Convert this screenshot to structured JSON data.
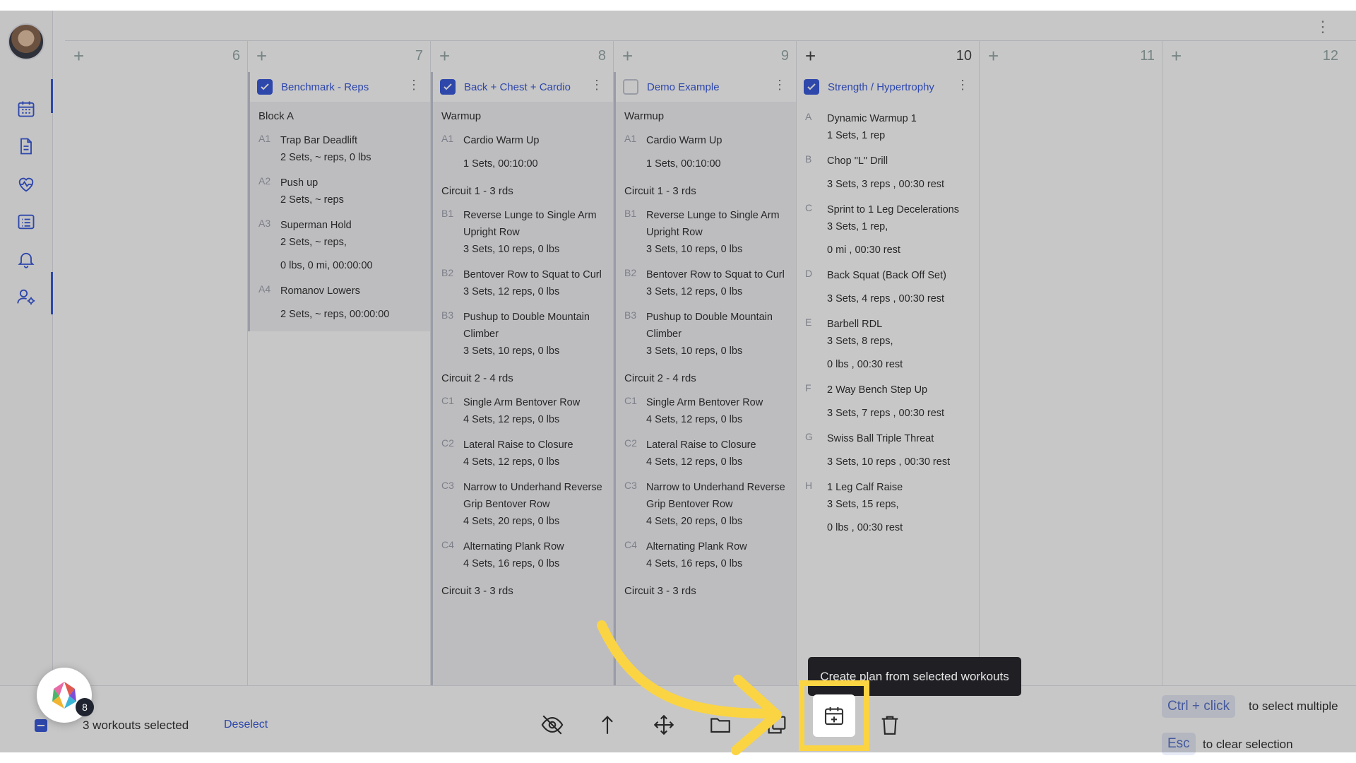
{
  "calendar": {
    "days": [
      "6",
      "7",
      "8",
      "9",
      "10",
      "11",
      "12"
    ],
    "workouts": [
      {
        "title": "Benchmark - Reps",
        "checked": true,
        "blocks": [
          {
            "section": "Block A",
            "items": [
              {
                "label": "A1",
                "name": "Trap Bar Deadlift",
                "details": [
                  "2 Sets, ~ reps, 0 lbs"
                ]
              },
              {
                "label": "A2",
                "name": "Push up",
                "details": [
                  "2 Sets, ~ reps"
                ]
              },
              {
                "label": "A3",
                "name": "Superman Hold",
                "details": [
                  "2 Sets, ~ reps,",
                  "0 lbs, 0 mi, 00:00:00"
                ]
              },
              {
                "label": "A4",
                "name": "Romanov Lowers",
                "details": [
                  "2 Sets, ~ reps, 00:00:00"
                ]
              }
            ]
          }
        ]
      },
      {
        "title": "Back + Chest + Cardio",
        "checked": true,
        "blocks": [
          {
            "section": "Warmup",
            "items": [
              {
                "label": "A1",
                "name": "Cardio Warm Up",
                "details": [
                  "1 Sets, 00:10:00"
                ]
              }
            ]
          },
          {
            "section": "Circuit 1 - 3 rds",
            "items": [
              {
                "label": "B1",
                "name": "Reverse Lunge to Single Arm Upright Row",
                "details": [
                  "3 Sets, 10 reps, 0 lbs"
                ]
              },
              {
                "label": "B2",
                "name": "Bentover Row to Squat to Curl",
                "details": [
                  "3 Sets, 12 reps, 0 lbs"
                ]
              },
              {
                "label": "B3",
                "name": "Pushup to Double Mountain Climber",
                "details": [
                  "3 Sets, 10 reps, 0 lbs"
                ]
              }
            ]
          },
          {
            "section": "Circuit 2 - 4 rds",
            "items": [
              {
                "label": "C1",
                "name": "Single Arm Bentover Row",
                "details": [
                  "4 Sets, 12 reps, 0 lbs"
                ]
              },
              {
                "label": "C2",
                "name": "Lateral Raise to Closure",
                "details": [
                  "4 Sets, 12 reps, 0 lbs"
                ]
              },
              {
                "label": "C3",
                "name": "Narrow to Underhand Reverse Grip Bentover Row",
                "details": [
                  "4 Sets, 20 reps, 0 lbs"
                ]
              },
              {
                "label": "C4",
                "name": "Alternating Plank Row",
                "details": [
                  "4 Sets, 16 reps, 0 lbs"
                ]
              }
            ]
          },
          {
            "section": "Circuit 3 - 3 rds",
            "items": []
          }
        ]
      },
      {
        "title": "Demo Example",
        "checked": false,
        "blocks": [
          {
            "section": "Warmup",
            "items": [
              {
                "label": "A1",
                "name": "Cardio Warm Up",
                "details": [
                  "1 Sets, 00:10:00"
                ]
              }
            ]
          },
          {
            "section": "Circuit 1 - 3 rds",
            "items": [
              {
                "label": "B1",
                "name": "Reverse Lunge to Single Arm Upright Row",
                "details": [
                  "3 Sets, 10 reps, 0 lbs"
                ]
              },
              {
                "label": "B2",
                "name": "Bentover Row to Squat to Curl",
                "details": [
                  "3 Sets, 12 reps, 0 lbs"
                ]
              },
              {
                "label": "B3",
                "name": "Pushup to Double Mountain Climber",
                "details": [
                  "3 Sets, 10 reps, 0 lbs"
                ]
              }
            ]
          },
          {
            "section": "Circuit 2 - 4 rds",
            "items": [
              {
                "label": "C1",
                "name": "Single Arm Bentover Row",
                "details": [
                  "4 Sets, 12 reps, 0 lbs"
                ]
              },
              {
                "label": "C2",
                "name": "Lateral Raise to Closure",
                "details": [
                  "4 Sets, 12 reps, 0 lbs"
                ]
              },
              {
                "label": "C3",
                "name": "Narrow to Underhand Reverse Grip Bentover Row",
                "details": [
                  "4 Sets, 20 reps, 0 lbs"
                ]
              },
              {
                "label": "C4",
                "name": "Alternating Plank Row",
                "details": [
                  "4 Sets, 16 reps, 0 lbs"
                ]
              }
            ]
          },
          {
            "section": "Circuit 3 - 3 rds",
            "items": []
          }
        ]
      },
      {
        "title": "Strength / Hypertrophy",
        "checked": true,
        "blocks": [
          {
            "section": "",
            "items": [
              {
                "label": "A",
                "name": "Dynamic Warmup 1",
                "details": [
                  "1 Sets, 1 rep"
                ]
              },
              {
                "label": "B",
                "name": "Chop \"L\" Drill",
                "details": [
                  "3 Sets, 3 reps , 00:30 rest"
                ]
              },
              {
                "label": "C",
                "name": "Sprint to 1 Leg Decelerations",
                "details": [
                  "3 Sets, 1 rep,",
                  "0 mi , 00:30 rest"
                ]
              },
              {
                "label": "D",
                "name": "Back Squat (Back Off Set)",
                "details": [
                  "3 Sets, 4 reps , 00:30 rest"
                ]
              },
              {
                "label": "E",
                "name": "Barbell RDL",
                "details": [
                  "3 Sets, 8 reps,",
                  "0 lbs , 00:30 rest"
                ]
              },
              {
                "label": "F",
                "name": "2 Way Bench Step Up",
                "details": [
                  "3 Sets, 7 reps , 00:30 rest"
                ]
              },
              {
                "label": "G",
                "name": "Swiss Ball Triple Threat",
                "details": [
                  "3 Sets, 10 reps , 00:30 rest"
                ]
              },
              {
                "label": "H",
                "name": "1 Leg Calf Raise",
                "details": [
                  "3 Sets, 15 reps,",
                  "0 lbs , 00:30 rest"
                ]
              }
            ]
          }
        ]
      }
    ]
  },
  "bottom_bar": {
    "selected_text": "3 workouts selected",
    "deselect_label": "Deselect",
    "tooltip": "Create plan from selected workouts",
    "hint_multi_key": "Ctrl + click",
    "hint_multi_text": "to select multiple",
    "hint_esc_key": "Esc",
    "hint_esc_text": "to clear selection",
    "badge_count": "8",
    "tools": [
      "hide-icon",
      "upload-icon",
      "move-icon",
      "folder-icon",
      "copy-icon",
      "calendar-plus-icon",
      "trash-icon"
    ]
  },
  "colors": {
    "accent": "#3b5bdb",
    "highlight": "#fbd443",
    "tooltip_bg": "#1f1f24"
  }
}
